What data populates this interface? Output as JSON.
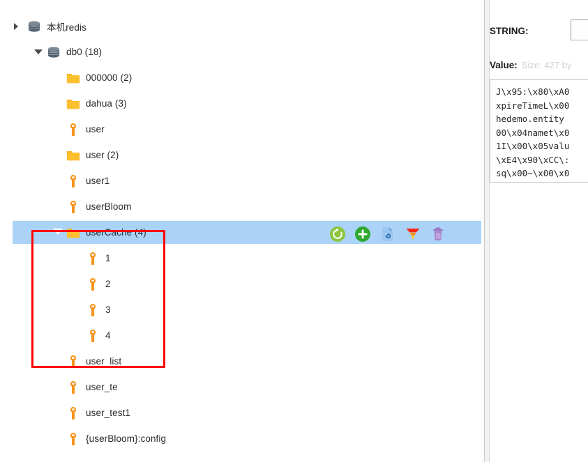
{
  "tree": {
    "rows": [
      {
        "label": "本机redis",
        "icon": "database-icon",
        "indent": 0,
        "twisty": "right-clip",
        "selected": false
      },
      {
        "label": "db0  (18)",
        "icon": "database-icon",
        "indent": 1,
        "twisty": "down",
        "selected": false
      },
      {
        "label": "000000 (2)",
        "icon": "folder-icon",
        "indent": 2,
        "twisty": "none",
        "selected": false
      },
      {
        "label": "dahua (3)",
        "icon": "folder-icon",
        "indent": 2,
        "twisty": "none",
        "selected": false
      },
      {
        "label": "user",
        "icon": "key-icon",
        "indent": 2,
        "twisty": "none",
        "selected": false
      },
      {
        "label": "user (2)",
        "icon": "folder-icon",
        "indent": 2,
        "twisty": "none",
        "selected": false
      },
      {
        "label": "user1",
        "icon": "key-icon",
        "indent": 2,
        "twisty": "none",
        "selected": false
      },
      {
        "label": "userBloom",
        "icon": "key-icon",
        "indent": 2,
        "twisty": "none",
        "selected": false
      },
      {
        "label": "userCache (4)",
        "icon": "folder-icon",
        "indent": 2,
        "twisty": "white-down",
        "selected": true
      },
      {
        "label": "1",
        "icon": "key-icon",
        "indent": 3,
        "twisty": "none",
        "selected": false
      },
      {
        "label": "2",
        "icon": "key-icon",
        "indent": 3,
        "twisty": "none",
        "selected": false
      },
      {
        "label": "3",
        "icon": "key-icon",
        "indent": 3,
        "twisty": "none",
        "selected": false
      },
      {
        "label": "4",
        "icon": "key-icon",
        "indent": 3,
        "twisty": "none",
        "selected": false
      },
      {
        "label": "user_list",
        "icon": "key-icon",
        "indent": 2,
        "twisty": "none",
        "selected": false
      },
      {
        "label": "user_te",
        "icon": "key-icon",
        "indent": 2,
        "twisty": "none",
        "selected": false
      },
      {
        "label": "user_test1",
        "icon": "key-icon",
        "indent": 2,
        "twisty": "none",
        "selected": false
      },
      {
        "label": "{userBloom}:config",
        "icon": "key-icon",
        "indent": 2,
        "twisty": "none",
        "selected": false
      }
    ],
    "actions": [
      {
        "name": "refresh-icon",
        "title": "Refresh"
      },
      {
        "name": "add-icon",
        "title": "Add"
      },
      {
        "name": "document-link-icon",
        "title": "Open"
      },
      {
        "name": "filter-funnel-icon",
        "title": "Filter"
      },
      {
        "name": "delete-trash-icon",
        "title": "Delete"
      }
    ]
  },
  "detail": {
    "type_label": "STRING:",
    "type_value": "",
    "value_label": "Value:",
    "value_size": "Size: 427 by",
    "value_lines": [
      "J\\x95:\\x80\\xA0",
      "xpireTimeL\\x00",
      "hedemo.entity",
      "00\\x04namet\\x0",
      "1I\\x00\\x05valu",
      "\\xE4\\x90\\xCC\\:",
      "sq\\x00~\\x00\\x0"
    ]
  },
  "colors": {
    "selection": "#ABD3F7",
    "folder": "#FCC02E",
    "key": "#F7941E",
    "database": "#53616E",
    "annotation": "#FF0000",
    "green_add": "#2EA82E",
    "green_refresh": "#8CC63F",
    "funnel_top": "#F22613",
    "funnel_bottom": "#FFC61A",
    "trash": "#9B72C4",
    "doc": "#9DC6F0"
  },
  "annotation": {
    "name": "red-highlight-box"
  }
}
